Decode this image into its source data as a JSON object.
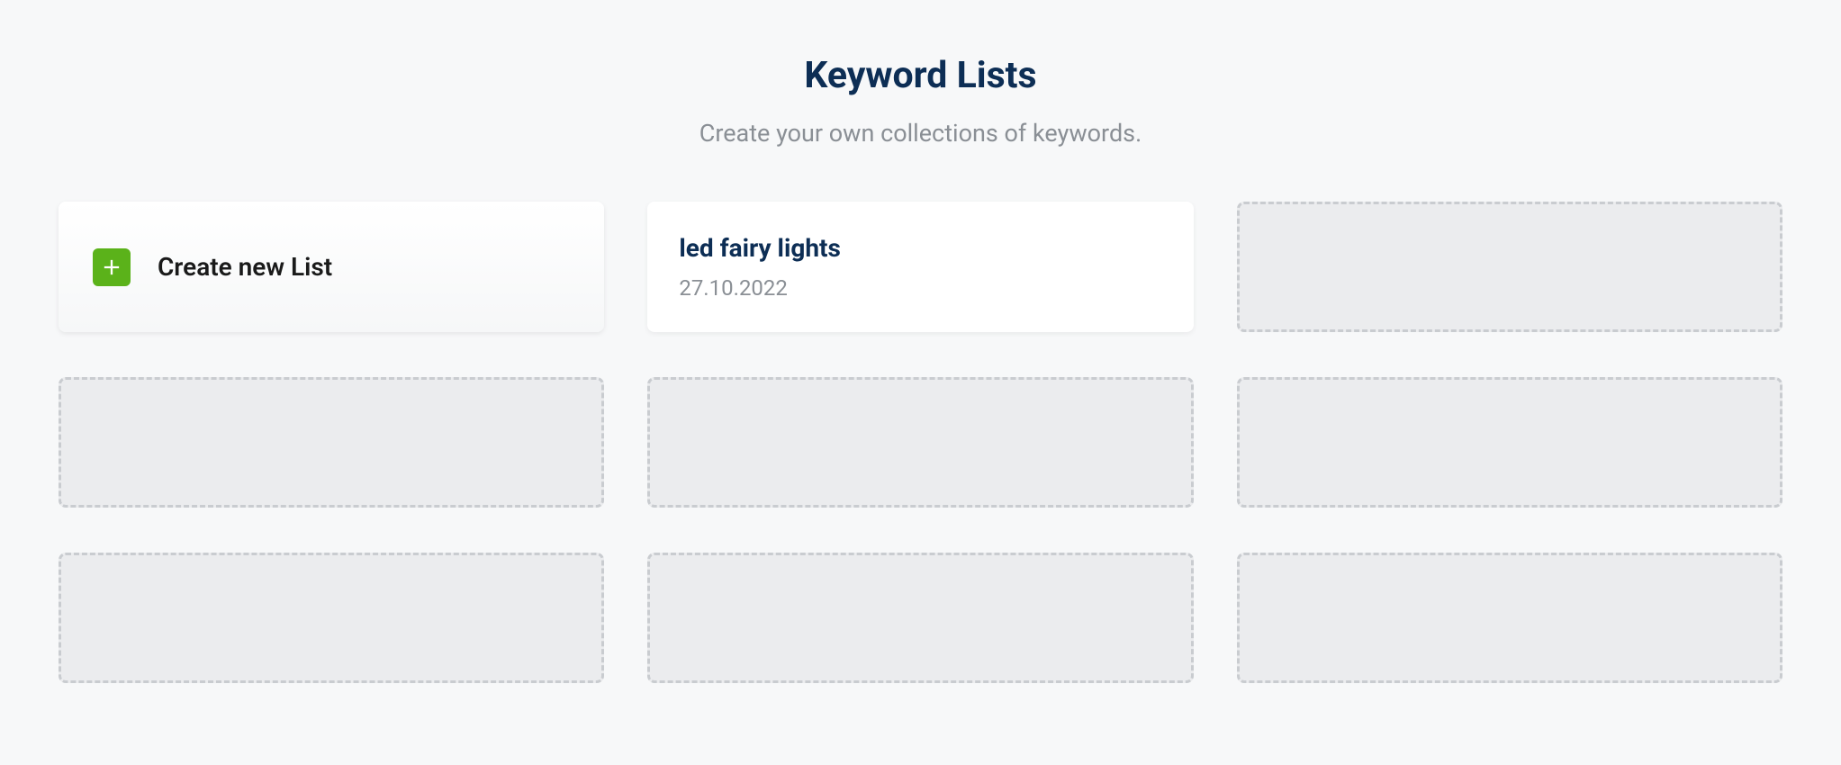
{
  "header": {
    "title": "Keyword Lists",
    "subtitle": "Create your own collections of keywords."
  },
  "create_button": {
    "label": "Create new List"
  },
  "lists": [
    {
      "name": "led fairy lights",
      "date": "27.10.2022"
    }
  ]
}
